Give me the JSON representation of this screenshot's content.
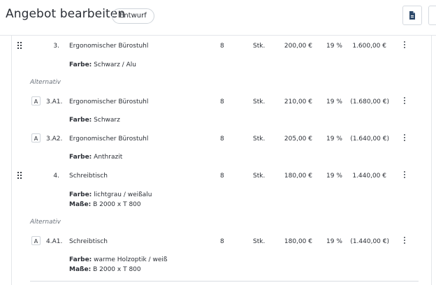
{
  "header": {
    "title": "Angebot bearbeiten",
    "status_badge": "Entwurf"
  },
  "rows": [
    {
      "pos": "3.",
      "name": "Ergonomischer Bürostuhl",
      "qty": "8",
      "unit": "Stk.",
      "price": "200,00 €",
      "tax": "19 %",
      "total": "1.600,00 €",
      "attrs": [
        {
          "label": "Farbe:",
          "value": "Schwarz / Alu"
        }
      ]
    },
    {
      "alt_label": "Alternativ"
    },
    {
      "tag": "A",
      "pos": "3.A1.",
      "name": "Ergonomischer Bürostuhl",
      "qty": "8",
      "unit": "Stk.",
      "price": "210,00 €",
      "tax": "19 %",
      "total": "(1.680,00 €)",
      "attrs": [
        {
          "label": "Farbe:",
          "value": "Schwarz"
        }
      ]
    },
    {
      "tag": "A",
      "pos": "3.A2.",
      "name": "Ergonomischer Bürostuhl",
      "qty": "8",
      "unit": "Stk.",
      "price": "205,00 €",
      "tax": "19 %",
      "total": "(1.640,00 €)",
      "attrs": [
        {
          "label": "Farbe:",
          "value": "Anthrazit"
        }
      ]
    },
    {
      "pos": "4.",
      "name": "Schreibtisch",
      "qty": "8",
      "unit": "Stk.",
      "price": "180,00 €",
      "tax": "19 %",
      "total": "1.440,00 €",
      "attrs": [
        {
          "label": "Farbe:",
          "value": "lichtgrau / weißalu"
        },
        {
          "label": "Maße:",
          "value": "B 2000 x T 800"
        }
      ]
    },
    {
      "alt_label": "Alternativ"
    },
    {
      "tag": "A",
      "pos": "4.A1.",
      "name": "Schreibtisch",
      "qty": "8",
      "unit": "Stk.",
      "price": "180,00 €",
      "tax": "19 %",
      "total": "(1.440,00 €)",
      "attrs": [
        {
          "label": "Farbe:",
          "value": "warme Holzoptik / weiß"
        },
        {
          "label": "Maße:",
          "value": "B 2000 x T 800"
        }
      ]
    }
  ]
}
